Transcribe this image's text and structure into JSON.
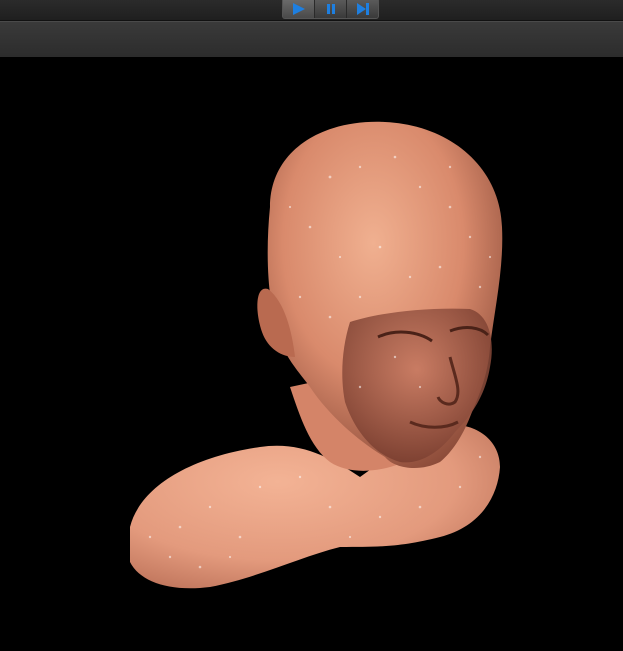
{
  "toolbar": {
    "buttons": [
      {
        "id": "play",
        "icon": "play-icon",
        "active": true
      },
      {
        "id": "pause",
        "icon": "pause-icon",
        "active": false
      },
      {
        "id": "step",
        "icon": "step-forward-icon",
        "active": false
      }
    ],
    "icon_color": "#1e7fe0"
  },
  "viewport": {
    "background": "#000000",
    "model": "head-bust-model",
    "skin_color": "#e39a7d"
  }
}
